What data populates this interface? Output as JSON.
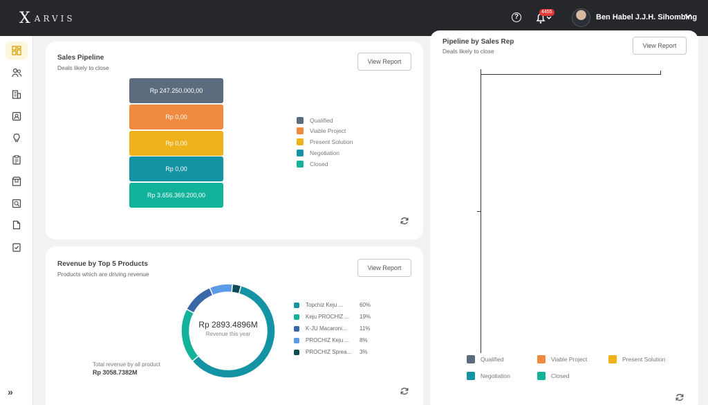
{
  "header": {
    "logo_text": "ARVIS",
    "notification_count": "4455",
    "user_name": "Ben Habel J.J.H. Sihombing"
  },
  "sales_pipeline": {
    "title": "Sales Pipeline",
    "subtitle": "Deals likely to close",
    "button": "View Report",
    "stages": [
      {
        "label": "Rp 247.250.000,00",
        "color": "#5d6b7e"
      },
      {
        "label": "Rp 0,00",
        "color": "#f08a3e"
      },
      {
        "label": "Rp 0,00",
        "color": "#f0b21a"
      },
      {
        "label": "Rp 0,00",
        "color": "#1393a3"
      },
      {
        "label": "Rp 3.656.369.200,00",
        "color": "#13b39b"
      }
    ],
    "legend": [
      "Qualified",
      "Viable Project",
      "Present Solution",
      "Negotiation",
      "Closed"
    ]
  },
  "revenue_products": {
    "title": "Revenue by Top 5 Products",
    "subtitle": "Products which are driving revenue",
    "button": "View Report",
    "center_value": "Rp 2893.4896M",
    "center_label": "Revenue this year",
    "total_label": "Total revenue by all product",
    "total_value": "Rp 3058.7382M",
    "products": [
      {
        "name": "Topchiz Keju ...",
        "pct": "60%",
        "color": "#1393a3"
      },
      {
        "name": "Keju PROCHIZ ...",
        "pct": "19%",
        "color": "#13b39b"
      },
      {
        "name": "K-JU Macaroni...",
        "pct": "11%",
        "color": "#3a67a8"
      },
      {
        "name": "PROCHIZ Keju ...",
        "pct": "8%",
        "color": "#5b9be8"
      },
      {
        "name": "PROCHIZ Sprea...",
        "pct": "3%",
        "color": "#0e4d55"
      }
    ]
  },
  "pipeline_rep": {
    "title": "Pipeline by Sales Rep",
    "subtitle": "Deals likely to close",
    "button": "View Report",
    "legend": [
      {
        "name": "Qualified",
        "color": "#5d6b7e"
      },
      {
        "name": "Viable Project",
        "color": "#f08a3e"
      },
      {
        "name": "Present Solution",
        "color": "#f0b21a"
      },
      {
        "name": "Negotiation",
        "color": "#1393a3"
      },
      {
        "name": "Closed",
        "color": "#13b39b"
      }
    ]
  }
}
